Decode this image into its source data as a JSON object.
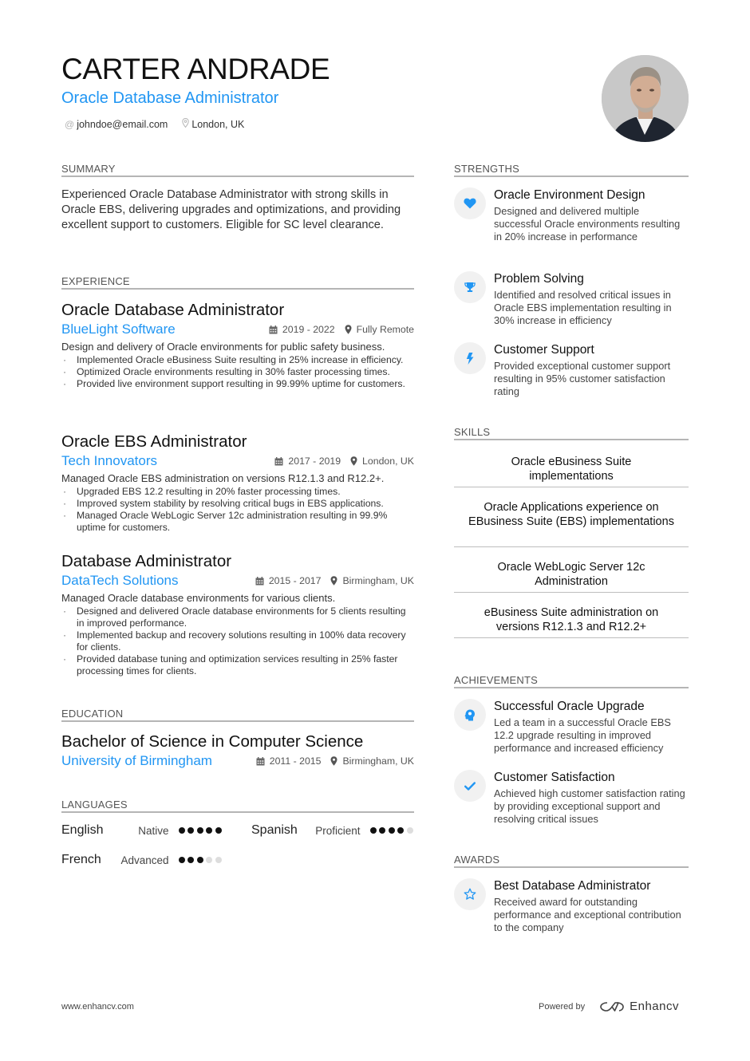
{
  "header": {
    "name": "CARTER ANDRADE",
    "role": "Oracle Database Administrator",
    "email": "johndoe@email.com",
    "location": "London, UK",
    "photo_alt": "Profile photo"
  },
  "colors": {
    "accent": "#2196f3",
    "rule": "#b5b5b5",
    "icon_bg": "#f1f1f1"
  },
  "sections": {
    "summary": "SUMMARY",
    "experience": "EXPERIENCE",
    "education": "EDUCATION",
    "languages": "LANGUAGES",
    "strengths": "STRENGTHS",
    "skills": "SKILLS",
    "achievements": "ACHIEVEMENTS",
    "awards": "AWARDS"
  },
  "summary": "Experienced Oracle Database Administrator with strong skills in Oracle EBS, delivering upgrades and optimizations, and providing excellent support to customers. Eligible for SC level clearance.",
  "experience": [
    {
      "title": "Oracle Database Administrator",
      "company": "BlueLight Software",
      "dates": "2019 - 2022",
      "location": "Fully Remote",
      "description": "Design and delivery of Oracle environments for public safety business.",
      "bullets": [
        "Implemented Oracle eBusiness Suite resulting in 25% increase in efficiency.",
        "Optimized Oracle environments resulting in 30% faster processing times.",
        "Provided live environment support resulting in 99.99% uptime for customers."
      ]
    },
    {
      "title": "Oracle EBS Administrator",
      "company": "Tech Innovators",
      "dates": "2017 - 2019",
      "location": "London, UK",
      "description": "Managed Oracle EBS administration on versions R12.1.3 and R12.2+.",
      "bullets": [
        "Upgraded EBS 12.2 resulting in 20% faster processing times.",
        "Improved system stability by resolving critical bugs in EBS applications.",
        "Managed Oracle WebLogic Server 12c administration resulting in 99.9% uptime for customers."
      ]
    },
    {
      "title": "Database Administrator",
      "company": "DataTech Solutions",
      "dates": "2015 - 2017",
      "location": "Birmingham, UK",
      "description": "Managed Oracle database environments for various clients.",
      "bullets": [
        "Designed and delivered Oracle database environments for 5 clients resulting in improved performance.",
        "Implemented backup and recovery solutions resulting in 100% data recovery for clients.",
        "Provided database tuning and optimization services resulting in 25% faster processing times for clients."
      ]
    }
  ],
  "education": {
    "degree": "Bachelor of Science in Computer Science",
    "school": "University of Birmingham",
    "dates": "2011 - 2015",
    "location": "Birmingham, UK"
  },
  "languages": [
    {
      "name": "English",
      "level": "Native",
      "rating": 5,
      "max": 5
    },
    {
      "name": "Spanish",
      "level": "Proficient",
      "rating": 4,
      "max": 5
    },
    {
      "name": "French",
      "level": "Advanced",
      "rating": 3,
      "max": 5
    }
  ],
  "strengths": [
    {
      "icon": "heart-icon",
      "title": "Oracle Environment Design",
      "description": "Designed and delivered multiple successful Oracle environments resulting in 20% increase in performance"
    },
    {
      "icon": "trophy-icon",
      "title": "Problem Solving",
      "description": "Identified and resolved critical issues in Oracle EBS implementation resulting in 30% increase in efficiency"
    },
    {
      "icon": "lightning-icon",
      "title": "Customer Support",
      "description": "Provided exceptional customer support resulting in 95% customer satisfaction rating"
    }
  ],
  "skills": [
    "Oracle eBusiness Suite implementations",
    "Oracle Applications experience on EBusiness Suite (EBS) implementations",
    "Oracle WebLogic Server 12c Administration",
    "eBusiness Suite administration on versions R12.1.3 and R12.2+"
  ],
  "achievements": [
    {
      "icon": "head-idea-icon",
      "title": "Successful Oracle Upgrade",
      "description": "Led a team in a successful Oracle EBS 12.2 upgrade resulting in improved performance and increased efficiency"
    },
    {
      "icon": "check-icon",
      "title": "Customer Satisfaction",
      "description": "Achieved high customer satisfaction rating by providing exceptional support and resolving critical issues"
    }
  ],
  "awards": [
    {
      "icon": "star-icon",
      "title": "Best Database Administrator",
      "description": "Received award for outstanding performance and exceptional contribution to the company"
    }
  ],
  "footer": {
    "website": "www.enhancv.com",
    "powered_by": "Powered by",
    "brand": "Enhancv"
  }
}
